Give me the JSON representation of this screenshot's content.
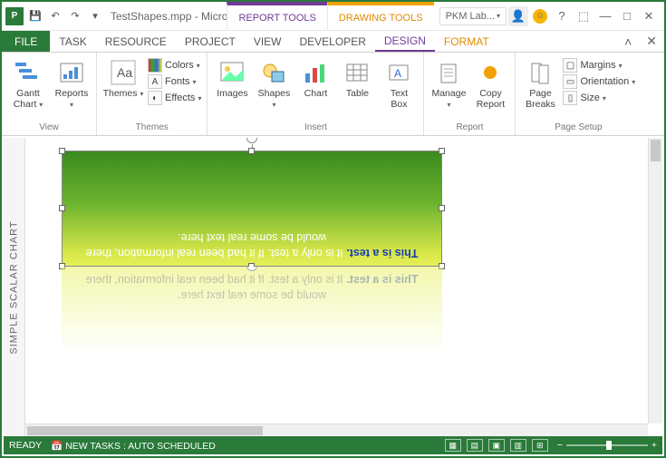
{
  "title": "TestShapes.mpp - Microsoft P...",
  "context_tabs": {
    "report": "REPORT TOOLS",
    "drawing": "DRAWING TOOLS"
  },
  "account": "PKM Lab...",
  "tabs": {
    "file": "FILE",
    "task": "TASK",
    "resource": "RESOURCE",
    "project": "PROJECT",
    "view": "VIEW",
    "developer": "DEVELOPER",
    "design": "DESIGN",
    "format": "FORMAT"
  },
  "ribbon": {
    "view": {
      "gantt": "Gantt\nChart",
      "reports": "Reports",
      "label": "View"
    },
    "themes": {
      "themes": "Themes",
      "colors": "Colors",
      "fonts": "Fonts",
      "effects": "Effects",
      "label": "Themes"
    },
    "insert": {
      "images": "Images",
      "shapes": "Shapes",
      "chart": "Chart",
      "table": "Table",
      "textbox": "Text\nBox",
      "label": "Insert"
    },
    "report": {
      "manage": "Manage",
      "copy": "Copy\nReport",
      "label": "Report"
    },
    "page_setup": {
      "breaks": "Page\nBreaks",
      "margins": "Margins",
      "orientation": "Orientation",
      "size": "Size",
      "label": "Page Setup"
    }
  },
  "side_label": "SIMPLE SCALAR CHART",
  "shape": {
    "bold": "This is a test.",
    "rest": " It is only a test. If it had been real information, there would be some real text here."
  },
  "status": {
    "ready": "READY",
    "newtasks": "NEW TASKS : AUTO SCHEDULED"
  }
}
